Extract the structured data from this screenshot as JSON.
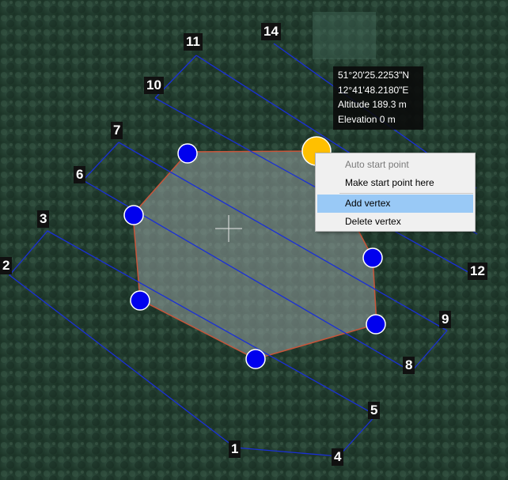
{
  "map": {
    "waypoint_labels": [
      "1",
      "2",
      "3",
      "4",
      "5",
      "6",
      "7",
      "8",
      "9",
      "10",
      "11",
      "12",
      "14"
    ]
  },
  "tooltip": {
    "latitude": "51°20'25.2253\"N",
    "longitude": "12°41'48.2180\"E",
    "altitude": "Altitude 189.3 m",
    "elevation": "Elevation 0 m"
  },
  "context_menu": {
    "items": [
      {
        "label": "Auto start point",
        "enabled": false
      },
      {
        "label": "Make start point here",
        "enabled": true
      },
      {
        "label": "Add vertex",
        "enabled": true,
        "highlighted": true
      },
      {
        "label": "Delete vertex",
        "enabled": true
      }
    ]
  },
  "colors": {
    "flight_path": "#1a2fd6",
    "vertex": "#0000ee",
    "selected_vertex": "#ffc000",
    "polygon_edge": "#c8553a",
    "menu_highlight": "#99c9f6"
  }
}
